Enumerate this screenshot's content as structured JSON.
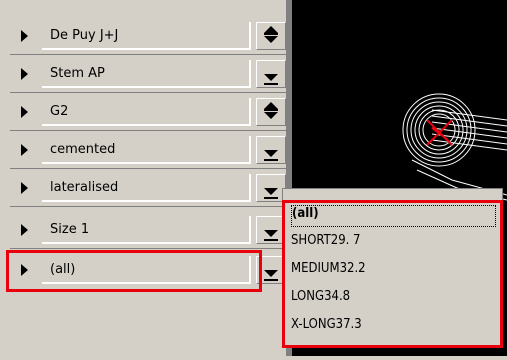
{
  "rows": [
    {
      "value": "De Puy J+J",
      "control": "stepper"
    },
    {
      "value": "Stem AP",
      "control": "dropdown"
    },
    {
      "value": "G2",
      "control": "stepper"
    },
    {
      "value": "cemented",
      "control": "dropdown"
    },
    {
      "value": "lateralised",
      "control": "dropdown"
    },
    {
      "value": "Size  1",
      "control": "dropdown"
    },
    {
      "value": "(all)",
      "control": "dropdown"
    }
  ],
  "dropdown": {
    "options": [
      {
        "label": "(all)",
        "selected": true
      },
      {
        "label": "SHORT29. 7"
      },
      {
        "label": "MEDIUM32.2"
      },
      {
        "label": "LONG34.8"
      },
      {
        "label": "X-LONG37.3"
      }
    ]
  },
  "colors": {
    "highlight": "#e8000d",
    "panel": "#d4d0c8",
    "canvas": "#000000"
  },
  "icons": [
    "play-arrow-icon",
    "stepper-icon",
    "dropdown-arrow-icon"
  ]
}
